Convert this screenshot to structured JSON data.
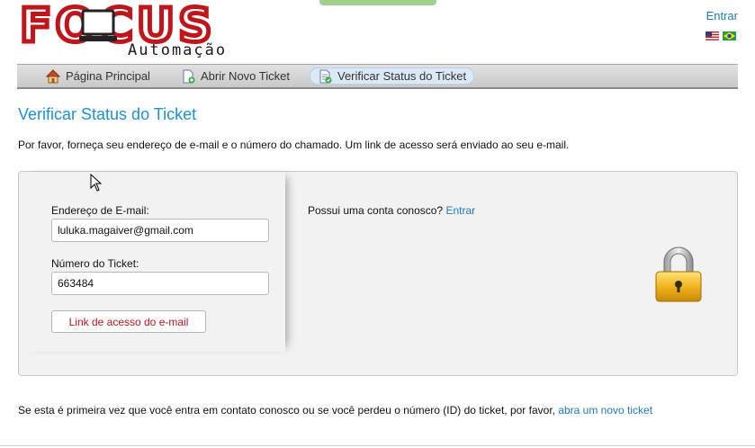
{
  "header": {
    "logo_main": "FOCUS",
    "logo_sub": "Automação",
    "signin_label": "Entrar",
    "flags": [
      "us-flag-icon",
      "brazil-flag-icon"
    ]
  },
  "nav": {
    "items": [
      {
        "label": "Página Principal",
        "icon": "home-icon"
      },
      {
        "label": "Abrir Novo Ticket",
        "icon": "new-ticket-icon"
      },
      {
        "label": "Verificar Status do Ticket",
        "icon": "ticket-status-icon",
        "active": true
      }
    ]
  },
  "page": {
    "title": "Verificar Status do Ticket",
    "intro": "Por favor, forneça seu endereço de e-mail e o número do chamado. Um link de acesso será enviado ao seu e-mail."
  },
  "form": {
    "email_label": "Endereço de E-mail:",
    "email_value": "luluka.magaiver@gmail.com",
    "ticket_label": "Número do Ticket:",
    "ticket_value": "663484",
    "submit_label": "Link de acesso do e-mail"
  },
  "account": {
    "prompt": "Possui uma conta conosco?",
    "link": "Entrar"
  },
  "footer": {
    "text": "Se esta é primeira vez que você entra em contato conosco ou se você perdeu o número (ID) do ticket, por favor,",
    "link": "abra um novo ticket"
  },
  "colors": {
    "accent": "#1f8fd4",
    "link": "#1f7ab8",
    "logo_red": "#c0161b",
    "button_text": "#c0161b"
  }
}
